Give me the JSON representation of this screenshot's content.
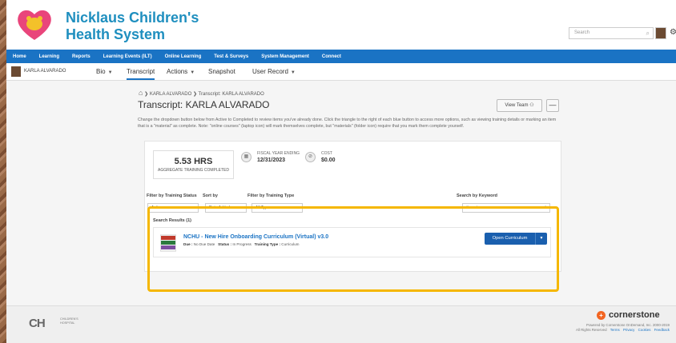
{
  "brand": {
    "org_name_line1": "Nicklaus Children's",
    "org_name_line2": "Health System",
    "heart_color": "#e9457b",
    "accent_color": "#1f8fbf"
  },
  "header": {
    "search_placeholder": "Search"
  },
  "nav": {
    "items": [
      "Home",
      "Learning",
      "Reports",
      "Learning Events (ILT)",
      "Online Learning",
      "Test & Surveys",
      "System Management",
      "Connect"
    ]
  },
  "subnav": {
    "user_name": "KARLA ALVARADO",
    "tabs": [
      "Bio",
      "Transcript",
      "Actions",
      "Snapshot",
      "User Record"
    ],
    "active_tab": "Transcript"
  },
  "breadcrumb": {
    "items": [
      "KARLA ALVARADO",
      "Transcript: KARLA ALVARADO"
    ]
  },
  "page": {
    "title": "Transcript: KARLA ALVARADO",
    "view_team_label": "View Team",
    "minus_label": "—",
    "description": "Change the dropdown button below from Active to Completed to review items you've already done. Click the triangle to the right of each blue button to access more options, such as viewing training details or marking an item that is a \"material\" as complete. Note: \"online courses\" (laptop icon) will mark themselves complete, but \"materials\" (folder icon) require that you mark them complete yourself."
  },
  "stats": {
    "hours_value": "5.53 HRS",
    "hours_label": "AGGREGATE TRAINING COMPLETED",
    "fiscal_label": "FISCAL YEAR ENDING",
    "fiscal_value": "12/31/2023",
    "cost_label": "COST",
    "cost_value": "$0.00"
  },
  "filters": {
    "status_label": "Filter by Training Status",
    "status_value": "Active",
    "sort_label": "Sort by",
    "sort_value": "Date Added",
    "type_label": "Filter by Training Type",
    "type_value": "All Types",
    "keyword_label": "Search by Keyword",
    "keyword_placeholder": "Search"
  },
  "results": {
    "label": "Search Results (1)",
    "items": [
      {
        "title": "NCHU - New Hire Onboarding Curriculum (Virtual) v3.0",
        "due_label": "Due :",
        "due_value": "No Due Date",
        "status_label": "Status :",
        "status_value": "In Progress",
        "type_label": "Training Type :",
        "type_value": "Curriculum",
        "action_label": "Open Curriculum"
      }
    ]
  },
  "highlight_color": "#f5b700",
  "footer": {
    "ch_logo_text": "CH",
    "ch_small_text": "CHILDREN'S HOSPITAL",
    "cs_name": "cornerstone",
    "copyright_line1": "Powered by Cornerstone OnDemand, Inc. 2000-2019",
    "copyright_line2": "All Rights Reserved",
    "links": [
      "Terms",
      "Privacy",
      "Cookies",
      "Feedback"
    ]
  }
}
